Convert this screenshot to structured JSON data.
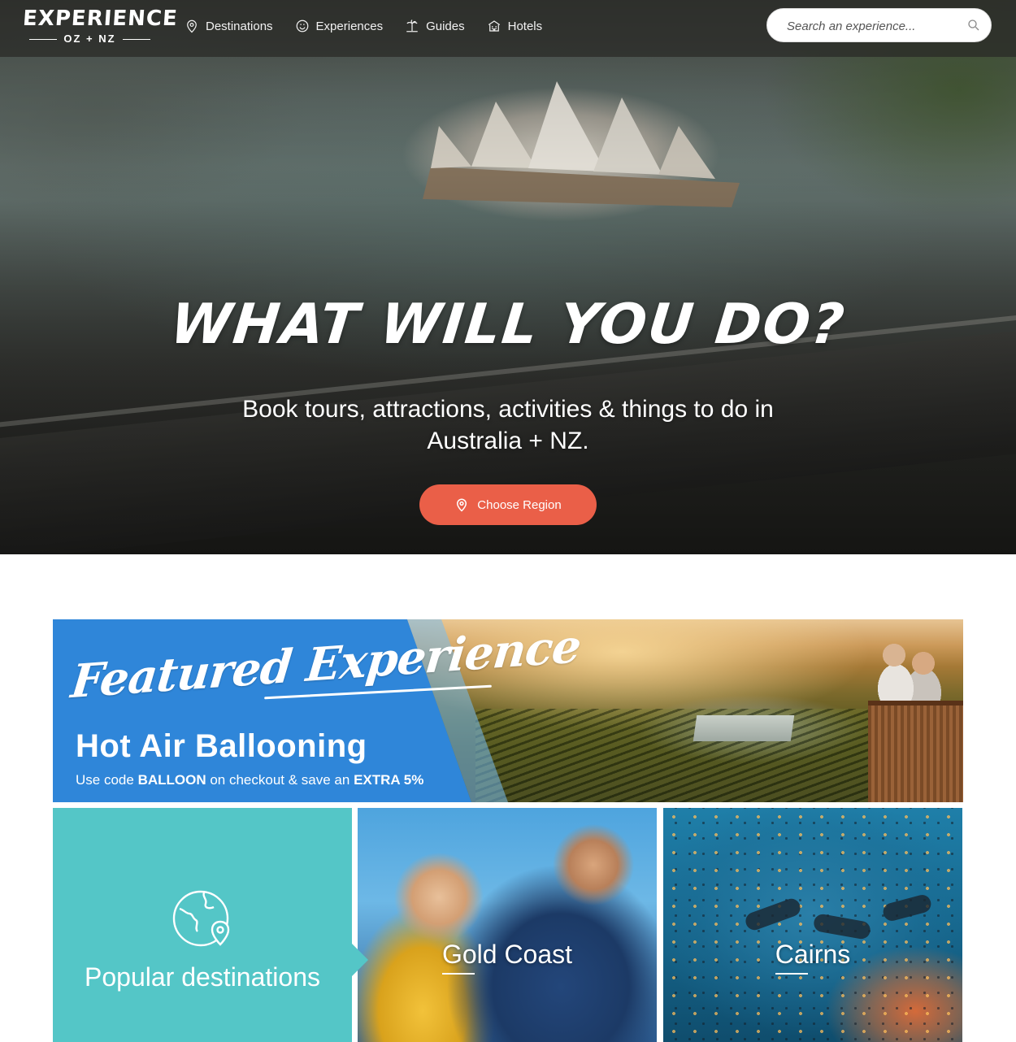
{
  "brand": {
    "logo_main": "EXPERIENCE",
    "logo_sub": "OZ + NZ"
  },
  "nav": {
    "items": [
      {
        "label": "Destinations",
        "icon": "map-pin-icon"
      },
      {
        "label": "Experiences",
        "icon": "smiley-icon"
      },
      {
        "label": "Guides",
        "icon": "palm-island-icon"
      },
      {
        "label": "Hotels",
        "icon": "hotel-icon"
      }
    ],
    "search": {
      "placeholder": "Search an experience...",
      "value": ""
    }
  },
  "hero": {
    "title": "WHAT WILL YOU DO?",
    "subtitle": "Book tours, attractions, activities & things to do in Australia + NZ.",
    "cta_label": "Choose Region"
  },
  "featured": {
    "script_heading": "Featured Experience",
    "title": "Hot Air Ballooning",
    "promo_prefix": "Use code",
    "promo_code": "BALLOON",
    "promo_middle": "on checkout & save an",
    "promo_discount": "EXTRA 5%"
  },
  "tiles": {
    "popular_label": "Popular destinations",
    "destinations": [
      {
        "label": "Gold Coast"
      },
      {
        "label": "Cairns"
      }
    ]
  },
  "colors": {
    "accent_button": "#ea5f48",
    "featured_blue": "#2f86d9",
    "popular_teal": "#54c6c7"
  }
}
